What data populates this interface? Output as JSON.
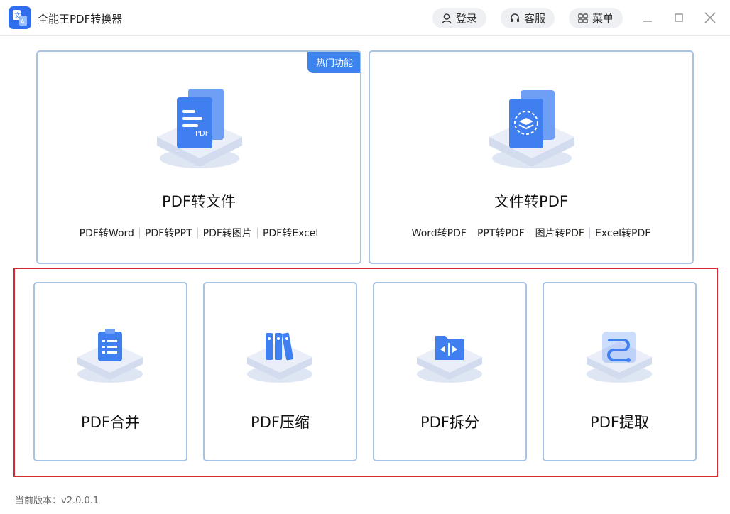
{
  "app": {
    "title": "全能王PDF转换器"
  },
  "header": {
    "login_label": "登录",
    "service_label": "客服",
    "menu_label": "菜单"
  },
  "main": {
    "pdf_to_file": {
      "badge": "热门功能",
      "title": "PDF转文件",
      "links": [
        "PDF转Word",
        "PDF转PPT",
        "PDF转图片",
        "PDF转Excel"
      ]
    },
    "file_to_pdf": {
      "title": "文件转PDF",
      "links": [
        "Word转PDF",
        "PPT转PDF",
        "图片转PDF",
        "Excel转PDF"
      ]
    },
    "tools": [
      {
        "title": "PDF合并",
        "icon": "clipboard-checklist-icon"
      },
      {
        "title": "PDF压缩",
        "icon": "binders-icon"
      },
      {
        "title": "PDF拆分",
        "icon": "split-folder-icon"
      },
      {
        "title": "PDF提取",
        "icon": "extract-path-icon"
      }
    ]
  },
  "footer": {
    "version": "当前版本：v2.0.0.1"
  },
  "colors": {
    "accent": "#3d83ed",
    "card_border": "#a9c3e4",
    "highlight_frame": "#d62b35"
  }
}
